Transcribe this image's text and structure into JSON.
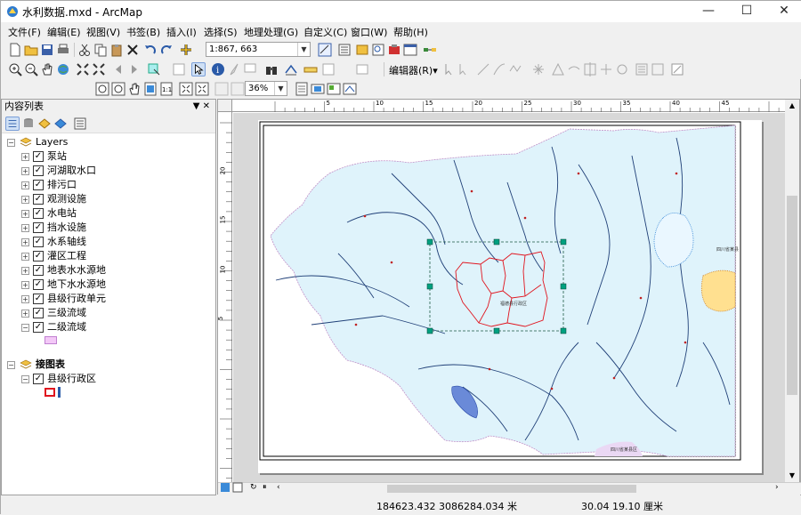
{
  "window": {
    "title": "水利数据.mxd - ArcMap",
    "minimize": "—",
    "maximize": "☐",
    "close": "✕"
  },
  "menu": [
    "文件(F)",
    "编辑(E)",
    "视图(V)",
    "书签(B)",
    "插入(I)",
    "选择(S)",
    "地理处理(G)",
    "自定义(C)",
    "窗口(W)",
    "帮助(H)"
  ],
  "toolbar": {
    "scale": "1:867, 663",
    "zoom_level": "36%",
    "editor_label": "编辑器(R)▾"
  },
  "toc": {
    "title": "内容列表",
    "pin": "▼ ✕",
    "group1": "Layers",
    "layers": [
      "泵站",
      "河湖取水口",
      "排污口",
      "观测设施",
      "水电站",
      "挡水设施",
      "水系轴线",
      "灌区工程",
      "地表水水源地",
      "地下水水源地",
      "县级行政单元",
      "三级流域",
      "二级流域"
    ],
    "group2": "接图表",
    "group2_layers": [
      "县级行政区"
    ]
  },
  "ruler": {
    "h_ticks": [
      "5",
      "10",
      "15",
      "20",
      "25",
      "30",
      "35",
      "40",
      "45"
    ],
    "v_ticks": [
      "20",
      "15",
      "10",
      "5"
    ]
  },
  "map": {
    "label_center": "福德县行政区",
    "label_right": "四川省某县",
    "label_bottom": "四川省某县区"
  },
  "status": {
    "coords": "184623.432  3086284.034 米",
    "page_coords": "30.04  19.10 厘米"
  },
  "colors": {
    "water": "#dff3fb",
    "river": "#1f3f77",
    "selection": "#e0141e",
    "handle": "#00a080"
  }
}
